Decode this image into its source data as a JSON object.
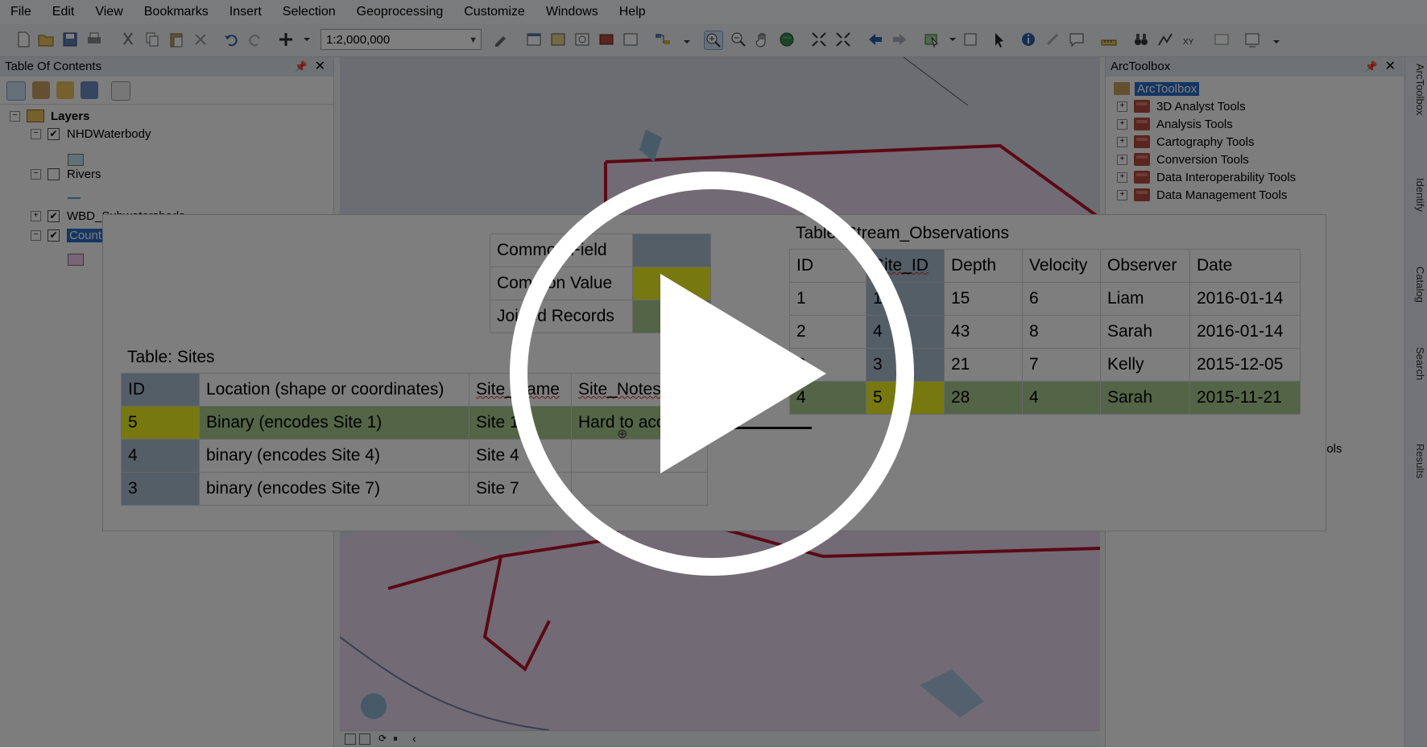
{
  "menu": [
    "File",
    "Edit",
    "View",
    "Bookmarks",
    "Insert",
    "Selection",
    "Geoprocessing",
    "Customize",
    "Windows",
    "Help"
  ],
  "toolbar": {
    "scale": "1:2,000,000"
  },
  "toc": {
    "title": "Table Of Contents",
    "root": "Layers",
    "layers": [
      {
        "label": "NHDWaterbody",
        "checked": true
      },
      {
        "label": "Rivers",
        "checked": false
      },
      {
        "label": "WBD_Subwatersheds",
        "checked": true
      },
      {
        "label": "Counties",
        "checked": true
      }
    ]
  },
  "toolbox": {
    "title": "ArcToolbox",
    "root": "ArcToolbox",
    "items": [
      "3D Analyst Tools",
      "Analysis Tools",
      "Cartography Tools",
      "Conversion Tools",
      "Data Interoperability Tools",
      "Data Management Tools"
    ],
    "partial_item": "ools"
  },
  "dock_tabs": [
    "ArcToolbox",
    "Identify",
    "Catalog",
    "Search",
    "Results"
  ],
  "legend": [
    "Common Field",
    "Common Value",
    "Joined Records"
  ],
  "sites_table": {
    "caption": "Table: Sites",
    "headers": [
      "ID",
      "Location (shape or coordinates)",
      "Site_Name",
      "Site_Notes"
    ],
    "rows": [
      [
        "5",
        "Binary (encodes Site 1)",
        "Site 1",
        "Hard to access"
      ],
      [
        "4",
        "binary (encodes Site 4)",
        "Site 4",
        ""
      ],
      [
        "3",
        "binary (encodes Site 7)",
        "Site 7",
        ""
      ]
    ]
  },
  "obs_table": {
    "caption": "Table: Stream_Observations",
    "headers": [
      "ID",
      "Site_ID",
      "Depth",
      "Velocity",
      "Observer",
      "Date"
    ],
    "rows": [
      [
        "1",
        "1",
        "15",
        "6",
        "Liam",
        "2016-01-14"
      ],
      [
        "2",
        "4",
        "43",
        "8",
        "Sarah",
        "2016-01-14"
      ],
      [
        "3",
        "3",
        "21",
        "7",
        "Kelly",
        "2015-12-05"
      ],
      [
        "4",
        "5",
        "28",
        "4",
        "Sarah",
        "2015-11-21"
      ]
    ]
  },
  "colors": {
    "common_field": "#a6bccf",
    "common_value": "#eef020",
    "joined_records": "#a7c98f",
    "boundary": "#b4122a"
  }
}
